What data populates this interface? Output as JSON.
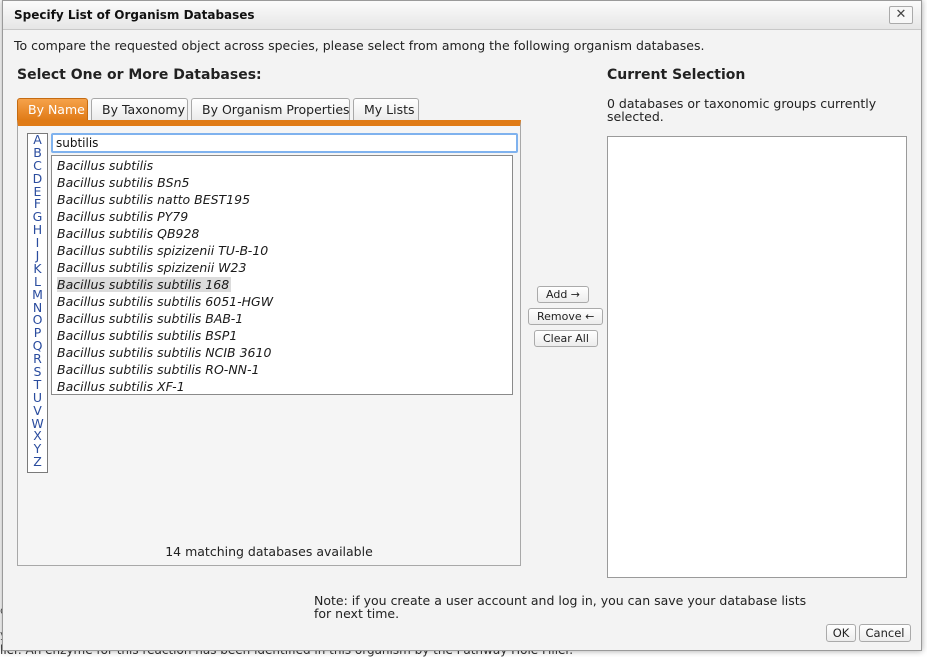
{
  "background": {
    "footer_text": "ller. An enzyme for this reaction has been identified in this organism by the Pathway Hole Filler.",
    "edge_chars": [
      "c",
      "y"
    ]
  },
  "dialog": {
    "title": "Specify List of Organism Databases",
    "close_label": "✕",
    "intro": "To compare the requested object across species, please select from among the following organism databases."
  },
  "left": {
    "heading": "Select One or More Databases:",
    "tabs": [
      {
        "label": "By Name",
        "active": true
      },
      {
        "label": "By Taxonomy",
        "active": false
      },
      {
        "label": "By Organism Properties",
        "active": false
      },
      {
        "label": "My Lists",
        "active": false
      }
    ],
    "letters": [
      "A",
      "B",
      "C",
      "D",
      "E",
      "F",
      "G",
      "H",
      "I",
      "J",
      "K",
      "L",
      "M",
      "N",
      "O",
      "P",
      "Q",
      "R",
      "S",
      "T",
      "U",
      "V",
      "W",
      "X",
      "Y",
      "Z"
    ],
    "search": {
      "value": "subtilis",
      "placeholder": ""
    },
    "results": [
      "Bacillus subtilis",
      "Bacillus subtilis BSn5",
      "Bacillus subtilis natto BEST195",
      "Bacillus subtilis PY79",
      "Bacillus subtilis QB928",
      "Bacillus subtilis spizizenii TU-B-10",
      "Bacillus subtilis spizizenii W23",
      "Bacillus subtilis subtilis 168",
      "Bacillus subtilis subtilis 6051-HGW",
      "Bacillus subtilis subtilis BAB-1",
      "Bacillus subtilis subtilis BSP1",
      "Bacillus subtilis subtilis NCIB 3610",
      "Bacillus subtilis subtilis RO-NN-1",
      "Bacillus subtilis XF-1"
    ],
    "highlighted_index": 7,
    "match_count": "14 matching databases available"
  },
  "middle": {
    "add_label": "Add →",
    "remove_label": "Remove ←",
    "clear_label": "Clear All"
  },
  "right": {
    "heading": "Current Selection",
    "status": "0 databases or taxonomic groups currently selected."
  },
  "footer": {
    "note": "Note: if you create a user account and log in, you can save your database lists for next time.",
    "ok_label": "OK",
    "cancel_label": "Cancel"
  },
  "colors": {
    "active_tab": "#e07b17",
    "letter_link": "#2a4c9e",
    "focus_ring": "#7fb2ee"
  }
}
